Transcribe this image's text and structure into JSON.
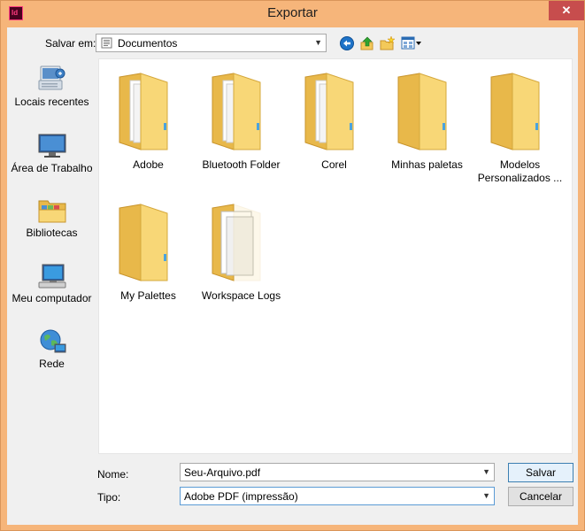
{
  "window": {
    "title": "Exportar",
    "app_icon_text": "Id",
    "close_glyph": "✕"
  },
  "toolbar": {
    "save_in_label": "Salvar em:",
    "location": "Documentos",
    "back_icon": "back-icon",
    "up_icon": "up-folder-icon",
    "new_folder_icon": "new-folder-icon",
    "view_icon": "view-menu-icon"
  },
  "places": [
    {
      "label": "Locais recentes",
      "icon": "recent-places-icon"
    },
    {
      "label": "Área de Trabalho",
      "icon": "desktop-icon"
    },
    {
      "label": "Bibliotecas",
      "icon": "libraries-icon"
    },
    {
      "label": "Meu computador",
      "icon": "computer-icon"
    },
    {
      "label": "Rede",
      "icon": "network-icon"
    }
  ],
  "files": [
    {
      "name": "Adobe"
    },
    {
      "name": "Bluetooth Folder"
    },
    {
      "name": "Corel"
    },
    {
      "name": "Minhas paletas"
    },
    {
      "name": "Modelos Personalizados ..."
    },
    {
      "name": "My Palettes"
    },
    {
      "name": "Workspace Logs"
    }
  ],
  "form": {
    "name_label": "Nome:",
    "name_value": "Seu-Arquivo.pdf",
    "type_label": "Tipo:",
    "type_value": "Adobe PDF (impressão)",
    "save_label": "Salvar",
    "cancel_label": "Cancelar"
  },
  "colors": {
    "frame": "#f6b57a",
    "folder_back": "#e8b84a",
    "folder_front": "#f8d777"
  }
}
